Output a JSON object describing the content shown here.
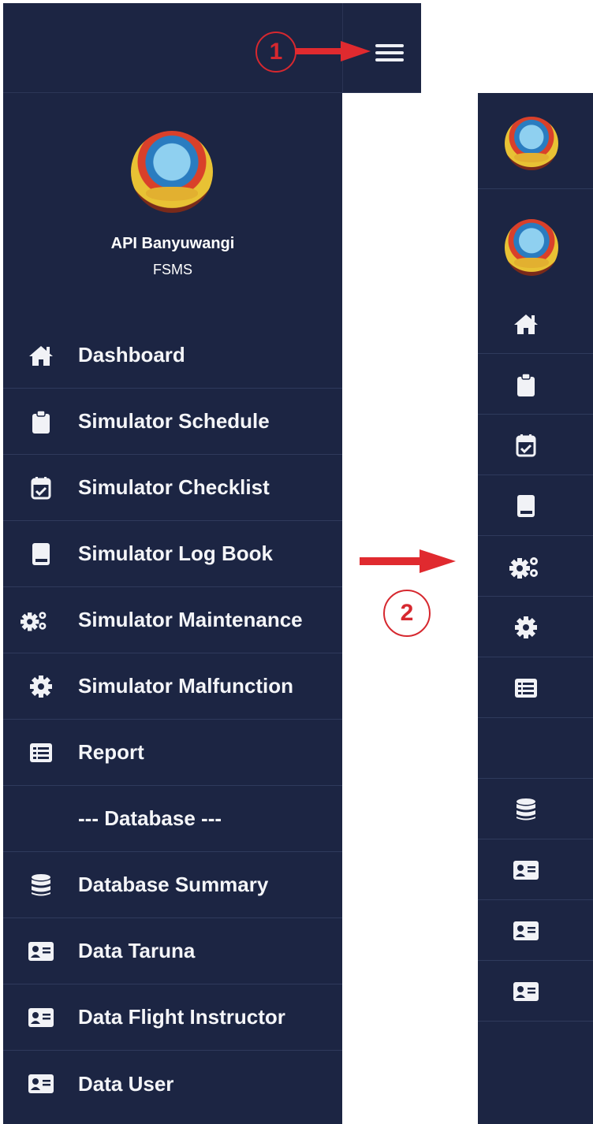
{
  "colors": {
    "sidebar_bg": "#1c2543",
    "text": "#ffffff",
    "annotation": "#d6282f"
  },
  "topbar": {
    "menu_icon": "hamburger-icon"
  },
  "brand": {
    "name": "API Banyuwangi",
    "subtitle": "FSMS"
  },
  "menu": {
    "items": [
      {
        "label": "Dashboard",
        "icon": "home-icon"
      },
      {
        "label": "Simulator Schedule",
        "icon": "clipboard-icon"
      },
      {
        "label": "Simulator Checklist",
        "icon": "calendar-check-icon"
      },
      {
        "label": "Simulator Log Book",
        "icon": "book-icon"
      },
      {
        "label": "Simulator Maintenance",
        "icon": "cogs-icon"
      },
      {
        "label": "Simulator Malfunction",
        "icon": "cog-icon"
      },
      {
        "label": "Report",
        "icon": "list-icon"
      },
      {
        "label": "--- Database ---",
        "icon": ""
      },
      {
        "label": "Database Summary",
        "icon": "database-icon"
      },
      {
        "label": "Data Taruna",
        "icon": "id-card-icon"
      },
      {
        "label": "Data Flight Instructor",
        "icon": "id-card-icon"
      },
      {
        "label": "Data User",
        "icon": "id-card-icon"
      }
    ]
  },
  "annotations": {
    "step1": "1",
    "step2": "2"
  }
}
